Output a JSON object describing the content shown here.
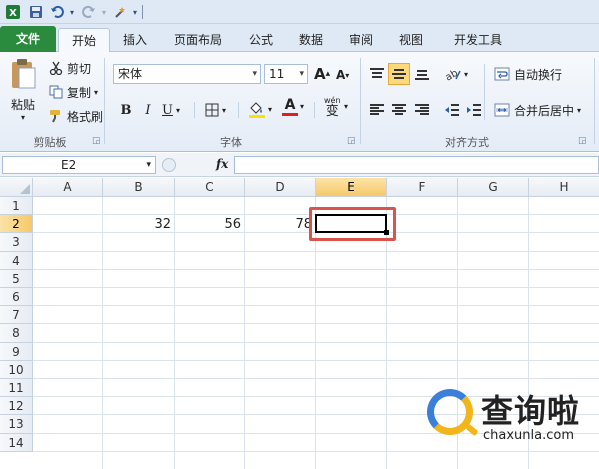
{
  "qat": {
    "icons": [
      "excel-app-icon",
      "save-icon",
      "undo-icon",
      "redo-icon",
      "customize-icon"
    ]
  },
  "tabs": [
    {
      "label": "文件",
      "kind": "file"
    },
    {
      "label": "开始",
      "kind": "active"
    },
    {
      "label": "插入",
      "kind": "normal"
    },
    {
      "label": "页面布局",
      "kind": "normal"
    },
    {
      "label": "公式",
      "kind": "normal"
    },
    {
      "label": "数据",
      "kind": "normal"
    },
    {
      "label": "审阅",
      "kind": "normal"
    },
    {
      "label": "视图",
      "kind": "normal"
    },
    {
      "label": "开发工具",
      "kind": "normal"
    }
  ],
  "clipboard": {
    "paste_label": "粘贴",
    "cut_label": "剪切",
    "copy_label": "复制",
    "format_painter_label": "格式刷",
    "group_label": "剪贴板"
  },
  "font": {
    "font_name": "宋体",
    "font_size": "11",
    "grow_label": "A",
    "shrink_label": "A",
    "bold_label": "B",
    "italic_label": "I",
    "underline_label": "U",
    "font_color_label": "A",
    "phonetic_label": "wén",
    "phonetic_char": "变",
    "group_label": "字体"
  },
  "alignment": {
    "wrap_text_label": "自动换行",
    "merge_center_label": "合并后居中",
    "group_label": "对齐方式"
  },
  "formula_bar": {
    "name_box": "E2",
    "fx_label": "fx",
    "formula_value": ""
  },
  "sheet": {
    "columns": [
      "A",
      "B",
      "C",
      "D",
      "E",
      "F",
      "G",
      "H"
    ],
    "rows": [
      "1",
      "2",
      "3",
      "4",
      "5",
      "6",
      "7",
      "8",
      "9",
      "10",
      "11",
      "12",
      "13",
      "14"
    ],
    "selected_column": "E",
    "selected_row": "2",
    "cells": {
      "B2": "32",
      "C2": "56",
      "D2": "78"
    }
  },
  "watermark": {
    "brand_text": "查询啦",
    "url": "chaxunla.com"
  },
  "colors": {
    "file_tab": "#2a8a3e",
    "selected_header": "#f5c96a",
    "highlight_box": "#d9534f",
    "watermark_blue": "#3b7fd9",
    "watermark_yellow": "#f2b51b"
  }
}
